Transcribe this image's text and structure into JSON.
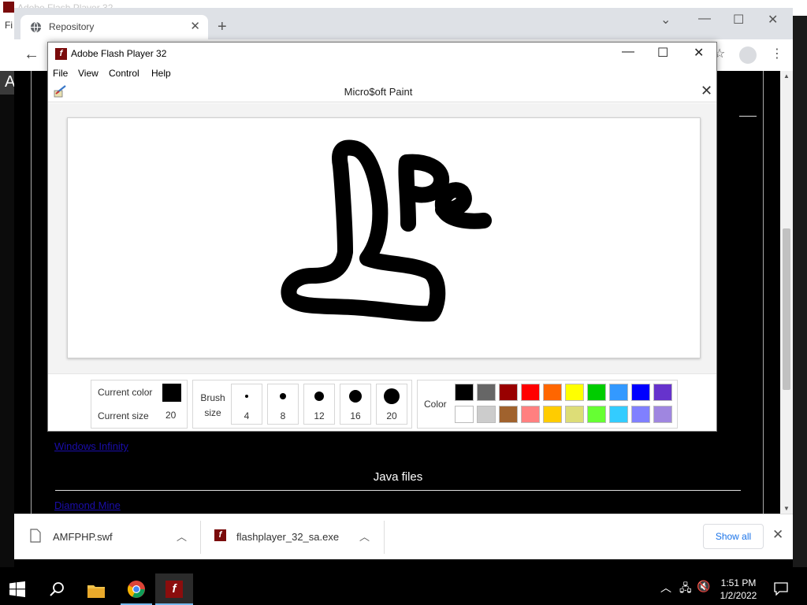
{
  "background": {
    "flash_title": "Adobe Flash Player 32",
    "menu_fragment": "Fi",
    "dark_fragment": "A"
  },
  "chrome": {
    "tab_title": "Repository",
    "new_tab": "+",
    "downloads": [
      {
        "name": "AMFPHP.swf"
      },
      {
        "name": "flashplayer_32_sa.exe"
      }
    ],
    "show_all": "Show all"
  },
  "webpage": {
    "links": [
      "Windows Infinity",
      "Diamond Mine"
    ],
    "section_heading": "Java files"
  },
  "flash": {
    "title": "Adobe Flash Player 32",
    "menu": [
      "File",
      "View",
      "Control",
      "Help"
    ]
  },
  "paint": {
    "title": "Micro$oft Paint",
    "current_color_label": "Current color",
    "current_size_label": "Current size",
    "current_size_value": "20",
    "current_color": "#000000",
    "brush_label_1": "Brush",
    "brush_label_2": "size",
    "brush_sizes": [
      "4",
      "8",
      "12",
      "16",
      "20"
    ],
    "color_label": "Color",
    "palette_row1": [
      "#000000",
      "#666666",
      "#990000",
      "#ff0000",
      "#ff6600",
      "#ffff00",
      "#00cc00",
      "#3399ff",
      "#0000ff",
      "#6633cc"
    ],
    "palette_row2": [
      "#ffffff",
      "#cccccc",
      "#a0622d",
      "#ff8080",
      "#ffcc00",
      "#dddd77",
      "#66ff33",
      "#33ccff",
      "#8080ff",
      "#9f86e0"
    ]
  },
  "taskbar": {
    "time": "1:51 PM",
    "date": "1/2/2022"
  }
}
